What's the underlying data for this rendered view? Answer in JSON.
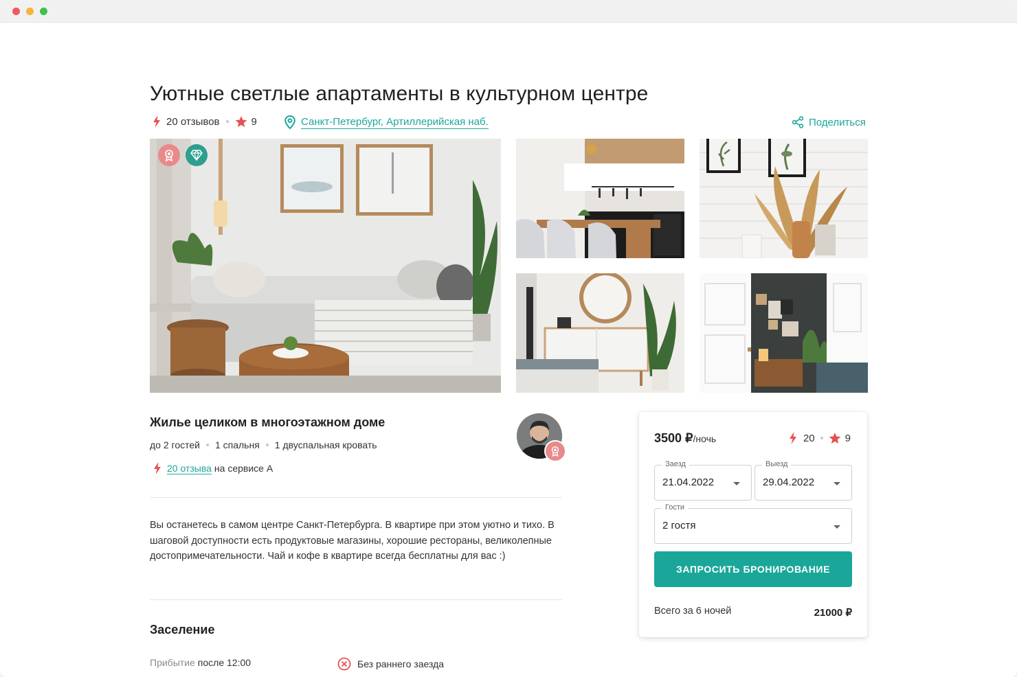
{
  "listing": {
    "title": "Уютные светлые апартаменты в культурном центре",
    "reviews_count_text": "20 отзывов",
    "rating": "9",
    "location": "Санкт-Петербург, Артиллерийская наб.",
    "share_label": "Поделиться"
  },
  "details": {
    "type_title": "Жилье целиком в многоэтажном доме",
    "features": [
      "до 2 гостей",
      "1 спальня",
      "1 двуспальная кровать"
    ],
    "reviews_link": "20 отзыва",
    "reviews_suffix": "на сервисе А",
    "description": "Вы останетесь в самом центре Санкт-Петербурга. В квартире при этом уютно и тихо. В шаговой доступности есть продуктовые магазины, хорошие рестораны, великолепные достопримечательности. Чай и кофе в квартире всегда бесплатны для вас :)"
  },
  "checkin": {
    "title": "Заселение",
    "arrival_label": "Прибытие",
    "arrival_value": "после 12:00",
    "early_checkin": "Без раннего заезда"
  },
  "booking": {
    "price": "3500 ₽",
    "per_night": "/ночь",
    "reviews_count": "20",
    "rating": "9",
    "checkin_label": "Заезд",
    "checkin_value": "21.04.2022",
    "checkout_label": "Выезд",
    "checkout_value": "29.04.2022",
    "guests_label": "Гости",
    "guests_value": "2 гостя",
    "button_label": "ЗАПРОСИТЬ БРОНИРОВАНИЕ",
    "total_label": "Всего за 6 ночей",
    "total_value": "21000 ₽"
  },
  "icons": {
    "reviews": "bolt-icon",
    "rating": "star-icon",
    "location": "location-pin-icon",
    "share": "share-icon",
    "superhost_badge": "award-icon",
    "premium_badge": "diamond-icon",
    "no_early_checkin": "cancel-circle-icon"
  },
  "colors": {
    "accent": "#1aa79a",
    "highlight": "#e6514f",
    "premium_badge": "#2e9e8f",
    "award_badge": "#e88a8a"
  }
}
